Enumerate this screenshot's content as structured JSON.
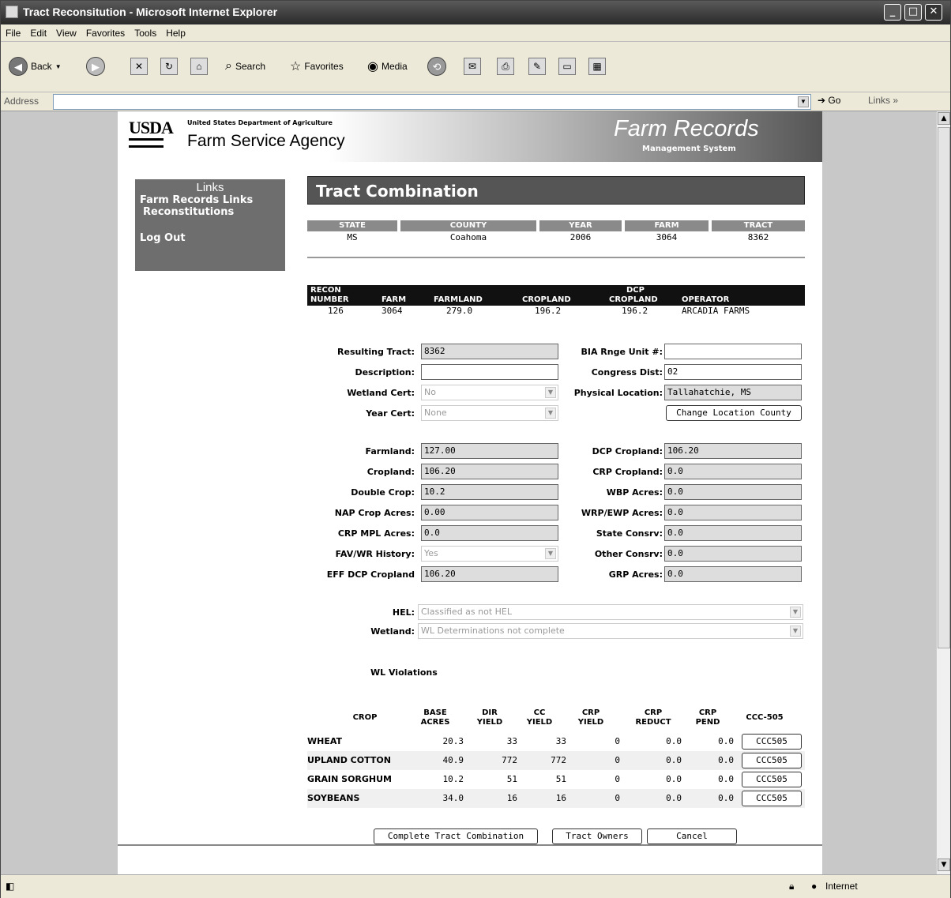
{
  "window": {
    "title": "Tract Reconsitution - Microsoft Internet Explorer"
  },
  "menu": [
    "File",
    "Edit",
    "View",
    "Favorites",
    "Tools",
    "Help"
  ],
  "toolbar": {
    "back": "Back",
    "search": "Search",
    "favorites": "Favorites",
    "media": "Media"
  },
  "address": {
    "label": "Address",
    "go": "Go",
    "links": "Links"
  },
  "banner": {
    "usda": "USDA",
    "dept": "United States Department of Agriculture",
    "agency": "Farm Service Agency",
    "app": "Farm Records",
    "sub": "Management System"
  },
  "links": {
    "heading": "Links",
    "items": [
      "Farm Records Links",
      "Reconstitutions",
      "Log Out"
    ]
  },
  "page_title": "Tract Combination",
  "header": {
    "cols": [
      "STATE",
      "COUNTY",
      "YEAR",
      "FARM",
      "TRACT"
    ],
    "vals": [
      "MS",
      "Coahoma",
      "2006",
      "3064",
      "8362"
    ]
  },
  "recon": {
    "h_recon1": "RECON",
    "h_recon2": "NUMBER",
    "h_farm": "FARM",
    "h_farmland": "FARMLAND",
    "h_cropland": "CROPLAND",
    "h_dcp1": "DCP",
    "h_dcp2": "CROPLAND",
    "h_operator": "OPERATOR",
    "v_number": "126",
    "v_farm": "3064",
    "v_farmland": "279.0",
    "v_cropland": "196.2",
    "v_dcp": "196.2",
    "v_operator": "ARCADIA FARMS"
  },
  "form": {
    "resulting_tract_label": "Resulting Tract:",
    "resulting_tract": "8362",
    "bia_label": "BIA Rnge Unit #:",
    "bia": "",
    "description_label": "Description:",
    "description": "",
    "congress_label": "Congress Dist:",
    "congress": "02",
    "wetland_cert_label": "Wetland Cert:",
    "wetland_cert": "No",
    "physical_label": "Physical Location:",
    "physical": "Tallahatchie, MS",
    "year_cert_label": "Year Cert:",
    "year_cert": "None",
    "change_location": "Change Location County",
    "farmland_label": "Farmland:",
    "farmland": "127.00",
    "dcp_cropland_label": "DCP Cropland:",
    "dcp_cropland": "106.20",
    "cropland_label": "Cropland:",
    "cropland": "106.20",
    "crp_cropland_label": "CRP Cropland:",
    "crp_cropland": "0.0",
    "double_crop_label": "Double Crop:",
    "double_crop": "10.2",
    "wbp_label": "WBP Acres:",
    "wbp": "0.0",
    "nap_label": "NAP Crop Acres:",
    "nap": "0.00",
    "wrp_label": "WRP/EWP Acres:",
    "wrp": "0.0",
    "crp_mpl_label": "CRP MPL Acres:",
    "crp_mpl": "0.0",
    "state_consrv_label": "State Consrv:",
    "state_consrv": "0.0",
    "fav_label": "FAV/WR History:",
    "fav": "Yes",
    "other_consrv_label": "Other Consrv:",
    "other_consrv": "0.0",
    "eff_dcp_label": "EFF DCP Cropland",
    "eff_dcp": "106.20",
    "grp_label": "GRP Acres:",
    "grp": "0.0",
    "hel_label": "HEL:",
    "hel": "Classified as not HEL",
    "wetland_label": "Wetland:",
    "wetland": "WL Determinations not complete",
    "wl_violations": "WL Violations"
  },
  "crops": {
    "headers": [
      [
        "CROP",
        ""
      ],
      [
        "BASE",
        "ACRES"
      ],
      [
        "DIR",
        "YIELD"
      ],
      [
        "CC",
        "YIELD"
      ],
      [
        "CRP",
        "YIELD"
      ],
      [
        "CRP",
        "REDUCT"
      ],
      [
        "CRP",
        "PEND"
      ],
      [
        "CCC-505",
        ""
      ]
    ],
    "rows": [
      {
        "crop": "WHEAT",
        "base": "20.3",
        "dir": "33",
        "cc": "33",
        "crp_yield": "0",
        "crp_reduct": "0.0",
        "crp_pend": "0.0",
        "btn": "CCC505"
      },
      {
        "crop": "UPLAND COTTON",
        "base": "40.9",
        "dir": "772",
        "cc": "772",
        "crp_yield": "0",
        "crp_reduct": "0.0",
        "crp_pend": "0.0",
        "btn": "CCC505"
      },
      {
        "crop": "GRAIN SORGHUM",
        "base": "10.2",
        "dir": "51",
        "cc": "51",
        "crp_yield": "0",
        "crp_reduct": "0.0",
        "crp_pend": "0.0",
        "btn": "CCC505"
      },
      {
        "crop": "SOYBEANS",
        "base": "34.0",
        "dir": "16",
        "cc": "16",
        "crp_yield": "0",
        "crp_reduct": "0.0",
        "crp_pend": "0.0",
        "btn": "CCC505"
      }
    ]
  },
  "buttons": {
    "complete": "Complete Tract Combination",
    "owners": "Tract Owners",
    "cancel": "Cancel"
  },
  "status": {
    "zone": "Internet"
  }
}
